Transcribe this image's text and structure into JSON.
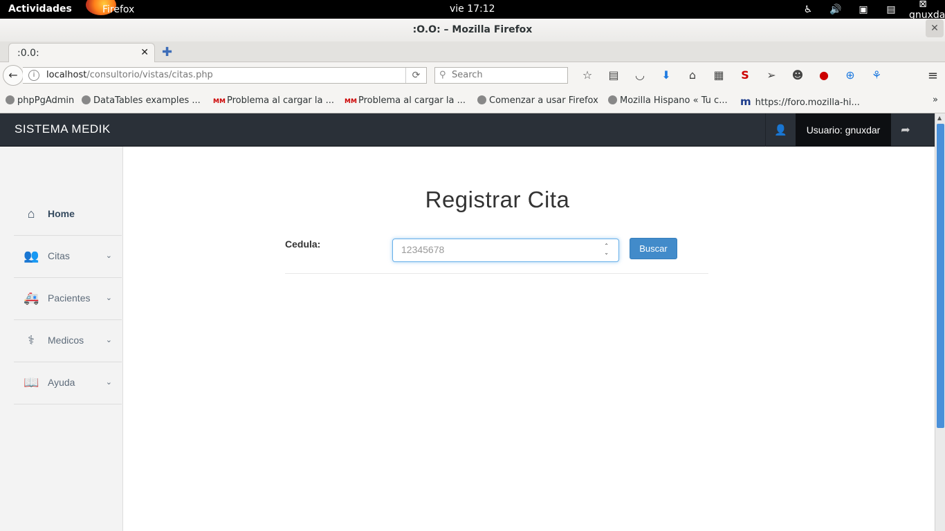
{
  "system": {
    "activities": "Actividades",
    "app_name": "Firefox",
    "clock": "vie 17:12",
    "user": "gnuxdar"
  },
  "window": {
    "title": ":O.O: – Mozilla Firefox",
    "close": "✕"
  },
  "tabs": [
    {
      "label": ":0.0:"
    }
  ],
  "navbar": {
    "url_host": "localhost",
    "url_path": "/consultorio/vistas/citas.php",
    "search_placeholder": "Search"
  },
  "bookmarks": [
    {
      "label": "phpPgAdmin"
    },
    {
      "label": "DataTables examples ..."
    },
    {
      "label": "Problema al cargar la ..."
    },
    {
      "label": "Problema al cargar la ..."
    },
    {
      "label": "Comenzar a usar Firefox"
    },
    {
      "label": "Mozilla Hispano « Tu c..."
    },
    {
      "label": "https://foro.mozilla-hi..."
    }
  ],
  "app": {
    "brand": "SISTEMA MEDIK",
    "user_label": "Usuario: gnuxdar"
  },
  "sidebar": {
    "items": [
      {
        "label": "Home",
        "icon": "home-icon"
      },
      {
        "label": "Citas",
        "icon": "users-icon"
      },
      {
        "label": "Pacientes",
        "icon": "ambulance-icon"
      },
      {
        "label": "Medicos",
        "icon": "doctor-icon"
      },
      {
        "label": "Ayuda",
        "icon": "book-icon"
      }
    ]
  },
  "main": {
    "title": "Registrar Cita",
    "cedula_label": "Cedula:",
    "cedula_placeholder": "12345678",
    "search_button": "Buscar"
  },
  "colors": {
    "navbar_bg": "#2a3038",
    "user_bg": "#0d0f12",
    "button_bg": "#428bca",
    "sidebar_bg": "#f3f3f3",
    "focus_border": "#66afe9"
  }
}
